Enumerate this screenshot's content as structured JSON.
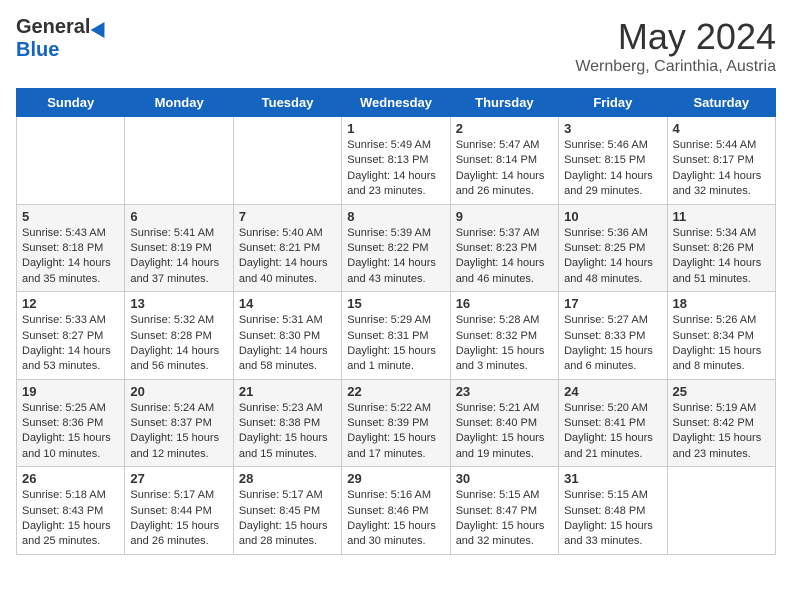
{
  "header": {
    "logo": {
      "general": "General",
      "blue": "Blue"
    },
    "title": "May 2024",
    "location": "Wernberg, Carinthia, Austria"
  },
  "days_of_week": [
    "Sunday",
    "Monday",
    "Tuesday",
    "Wednesday",
    "Thursday",
    "Friday",
    "Saturday"
  ],
  "weeks": [
    [
      {
        "day": "",
        "info": ""
      },
      {
        "day": "",
        "info": ""
      },
      {
        "day": "",
        "info": ""
      },
      {
        "day": "1",
        "info": "Sunrise: 5:49 AM\nSunset: 8:13 PM\nDaylight: 14 hours and 23 minutes."
      },
      {
        "day": "2",
        "info": "Sunrise: 5:47 AM\nSunset: 8:14 PM\nDaylight: 14 hours and 26 minutes."
      },
      {
        "day": "3",
        "info": "Sunrise: 5:46 AM\nSunset: 8:15 PM\nDaylight: 14 hours and 29 minutes."
      },
      {
        "day": "4",
        "info": "Sunrise: 5:44 AM\nSunset: 8:17 PM\nDaylight: 14 hours and 32 minutes."
      }
    ],
    [
      {
        "day": "5",
        "info": "Sunrise: 5:43 AM\nSunset: 8:18 PM\nDaylight: 14 hours and 35 minutes."
      },
      {
        "day": "6",
        "info": "Sunrise: 5:41 AM\nSunset: 8:19 PM\nDaylight: 14 hours and 37 minutes."
      },
      {
        "day": "7",
        "info": "Sunrise: 5:40 AM\nSunset: 8:21 PM\nDaylight: 14 hours and 40 minutes."
      },
      {
        "day": "8",
        "info": "Sunrise: 5:39 AM\nSunset: 8:22 PM\nDaylight: 14 hours and 43 minutes."
      },
      {
        "day": "9",
        "info": "Sunrise: 5:37 AM\nSunset: 8:23 PM\nDaylight: 14 hours and 46 minutes."
      },
      {
        "day": "10",
        "info": "Sunrise: 5:36 AM\nSunset: 8:25 PM\nDaylight: 14 hours and 48 minutes."
      },
      {
        "day": "11",
        "info": "Sunrise: 5:34 AM\nSunset: 8:26 PM\nDaylight: 14 hours and 51 minutes."
      }
    ],
    [
      {
        "day": "12",
        "info": "Sunrise: 5:33 AM\nSunset: 8:27 PM\nDaylight: 14 hours and 53 minutes."
      },
      {
        "day": "13",
        "info": "Sunrise: 5:32 AM\nSunset: 8:28 PM\nDaylight: 14 hours and 56 minutes."
      },
      {
        "day": "14",
        "info": "Sunrise: 5:31 AM\nSunset: 8:30 PM\nDaylight: 14 hours and 58 minutes."
      },
      {
        "day": "15",
        "info": "Sunrise: 5:29 AM\nSunset: 8:31 PM\nDaylight: 15 hours and 1 minute."
      },
      {
        "day": "16",
        "info": "Sunrise: 5:28 AM\nSunset: 8:32 PM\nDaylight: 15 hours and 3 minutes."
      },
      {
        "day": "17",
        "info": "Sunrise: 5:27 AM\nSunset: 8:33 PM\nDaylight: 15 hours and 6 minutes."
      },
      {
        "day": "18",
        "info": "Sunrise: 5:26 AM\nSunset: 8:34 PM\nDaylight: 15 hours and 8 minutes."
      }
    ],
    [
      {
        "day": "19",
        "info": "Sunrise: 5:25 AM\nSunset: 8:36 PM\nDaylight: 15 hours and 10 minutes."
      },
      {
        "day": "20",
        "info": "Sunrise: 5:24 AM\nSunset: 8:37 PM\nDaylight: 15 hours and 12 minutes."
      },
      {
        "day": "21",
        "info": "Sunrise: 5:23 AM\nSunset: 8:38 PM\nDaylight: 15 hours and 15 minutes."
      },
      {
        "day": "22",
        "info": "Sunrise: 5:22 AM\nSunset: 8:39 PM\nDaylight: 15 hours and 17 minutes."
      },
      {
        "day": "23",
        "info": "Sunrise: 5:21 AM\nSunset: 8:40 PM\nDaylight: 15 hours and 19 minutes."
      },
      {
        "day": "24",
        "info": "Sunrise: 5:20 AM\nSunset: 8:41 PM\nDaylight: 15 hours and 21 minutes."
      },
      {
        "day": "25",
        "info": "Sunrise: 5:19 AM\nSunset: 8:42 PM\nDaylight: 15 hours and 23 minutes."
      }
    ],
    [
      {
        "day": "26",
        "info": "Sunrise: 5:18 AM\nSunset: 8:43 PM\nDaylight: 15 hours and 25 minutes."
      },
      {
        "day": "27",
        "info": "Sunrise: 5:17 AM\nSunset: 8:44 PM\nDaylight: 15 hours and 26 minutes."
      },
      {
        "day": "28",
        "info": "Sunrise: 5:17 AM\nSunset: 8:45 PM\nDaylight: 15 hours and 28 minutes."
      },
      {
        "day": "29",
        "info": "Sunrise: 5:16 AM\nSunset: 8:46 PM\nDaylight: 15 hours and 30 minutes."
      },
      {
        "day": "30",
        "info": "Sunrise: 5:15 AM\nSunset: 8:47 PM\nDaylight: 15 hours and 32 minutes."
      },
      {
        "day": "31",
        "info": "Sunrise: 5:15 AM\nSunset: 8:48 PM\nDaylight: 15 hours and 33 minutes."
      },
      {
        "day": "",
        "info": ""
      }
    ]
  ]
}
